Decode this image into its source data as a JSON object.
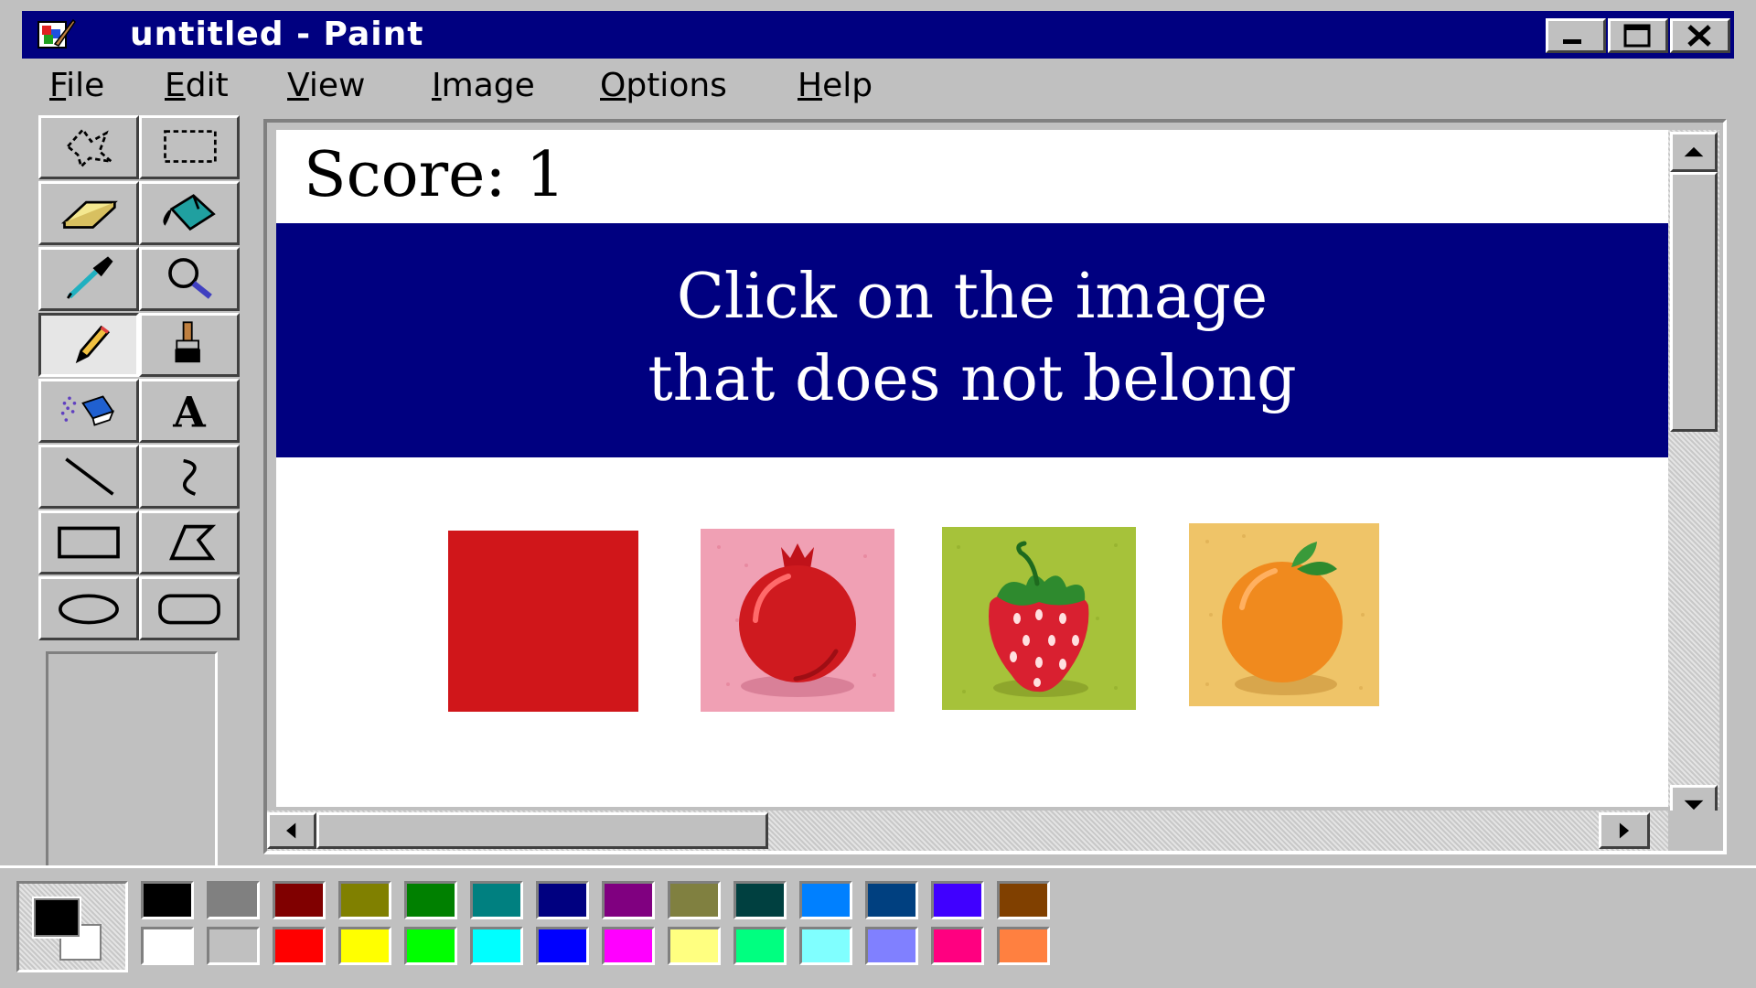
{
  "window": {
    "title": "untitled - Paint"
  },
  "menu": {
    "items": [
      {
        "mnemonic": "F",
        "rest": "ile"
      },
      {
        "mnemonic": "E",
        "rest": "dit"
      },
      {
        "mnemonic": "V",
        "rest": "iew"
      },
      {
        "mnemonic": "I",
        "rest": "mage"
      },
      {
        "mnemonic": "O",
        "rest": "ptions"
      },
      {
        "mnemonic": "H",
        "rest": "elp"
      }
    ]
  },
  "tools": [
    {
      "icon": "free-select-icon"
    },
    {
      "icon": "rect-select-icon"
    },
    {
      "icon": "eraser-icon"
    },
    {
      "icon": "fill-bucket-icon"
    },
    {
      "icon": "color-picker-icon"
    },
    {
      "icon": "magnifier-icon"
    },
    {
      "icon": "pencil-icon",
      "active": true
    },
    {
      "icon": "brush-icon"
    },
    {
      "icon": "airbrush-icon"
    },
    {
      "icon": "text-icon",
      "glyph": "A"
    },
    {
      "icon": "line-icon"
    },
    {
      "icon": "curve-icon"
    },
    {
      "icon": "rectangle-icon"
    },
    {
      "icon": "polygon-icon"
    },
    {
      "icon": "ellipse-icon"
    },
    {
      "icon": "rounded-rect-icon"
    }
  ],
  "canvas": {
    "score_text": "Score: 1",
    "instruction_line1": "Click on the image",
    "instruction_line2": "that does not belong",
    "banner_color": "#000080",
    "choices": [
      {
        "name": "red-square",
        "color": "#d0161a"
      },
      {
        "name": "pomegranate",
        "bg": "#f0a0b4",
        "color": "#d0161a"
      },
      {
        "name": "strawberry",
        "bg": "#a6c23a",
        "color": "#d0161a"
      },
      {
        "name": "orange",
        "bg": "#efc468",
        "color": "#f08a1e"
      }
    ]
  },
  "palette": {
    "foreground": "#000000",
    "background": "#ffffff",
    "top_row": [
      "#000000",
      "#808080",
      "#800000",
      "#808000",
      "#008000",
      "#008080",
      "#000080",
      "#800080",
      "#808040",
      "#004040",
      "#0080ff",
      "#004080",
      "#4000ff",
      "#804000"
    ],
    "bottom_row": [
      "#ffffff",
      "#c0c0c0",
      "#ff0000",
      "#ffff00",
      "#00ff00",
      "#00ffff",
      "#0000ff",
      "#ff00ff",
      "#ffff80",
      "#00ff80",
      "#80ffff",
      "#8080ff",
      "#ff0080",
      "#ff8040"
    ]
  }
}
